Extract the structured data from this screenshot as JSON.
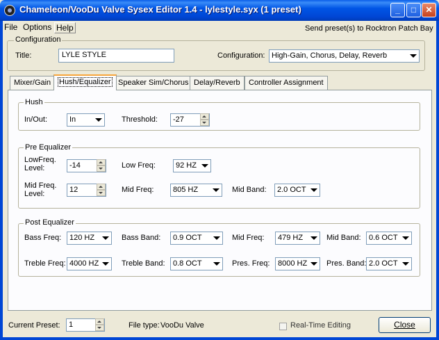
{
  "window": {
    "title": "Chameleon/VooDu Valve Sysex Editor 1.4 - lylestyle.syx (1 preset)"
  },
  "menu": {
    "file": "File",
    "options": "Options",
    "help": "Help",
    "send_link": "Send preset(s) to Rocktron Patch Bay"
  },
  "configuration": {
    "group_label": "Configuration",
    "title_label": "Title:",
    "title_value": "LYLE STYLE",
    "config_label": "Configuration:",
    "config_value": "High-Gain, Chorus, Delay, Reverb"
  },
  "tabs": [
    {
      "label": "Mixer/Gain"
    },
    {
      "label": "Hush/Equalizer",
      "active": true
    },
    {
      "label": "Speaker Sim/Chorus"
    },
    {
      "label": "Delay/Reverb"
    },
    {
      "label": "Controller Assignment"
    }
  ],
  "hush": {
    "group_label": "Hush",
    "inout_label": "In/Out:",
    "inout_value": "In",
    "threshold_label": "Threshold:",
    "threshold_value": "-27"
  },
  "pre_eq": {
    "group_label": "Pre Equalizer",
    "low_level_label_1": "LowFreq.",
    "low_level_label_2": "Level:",
    "low_level_value": "-14",
    "low_freq_label": "Low Freq:",
    "low_freq_value": "92 HZ",
    "mid_level_label_1": "Mid Freq.",
    "mid_level_label_2": "Level:",
    "mid_level_value": "12",
    "mid_freq_label": "Mid Freq:",
    "mid_freq_value": "805 HZ",
    "mid_band_label": "Mid Band:",
    "mid_band_value": "2.0 OCT"
  },
  "post_eq": {
    "group_label": "Post Equalizer",
    "bass_freq_label": "Bass Freq:",
    "bass_freq_value": "120 HZ",
    "bass_band_label": "Bass Band:",
    "bass_band_value": "0.9 OCT",
    "mid_freq_label": "Mid Freq:",
    "mid_freq_value": "479 HZ",
    "mid_band_label": "Mid Band:",
    "mid_band_value": "0.6 OCT",
    "treble_freq_label": "Treble Freq:",
    "treble_freq_value": "4000 HZ",
    "treble_band_label": "Treble Band:",
    "treble_band_value": "0.8 OCT",
    "pres_freq_label": "Pres. Freq:",
    "pres_freq_value": "8000 HZ",
    "pres_band_label": "Pres. Band:",
    "pres_band_value": "2.0 OCT"
  },
  "footer": {
    "current_preset_label": "Current Preset:",
    "current_preset_value": "1",
    "file_type_label": "File type:",
    "file_type_value": "VooDu Valve",
    "realtime_label": "Real-Time Editing",
    "realtime_checked": false,
    "close_label": "Close"
  }
}
